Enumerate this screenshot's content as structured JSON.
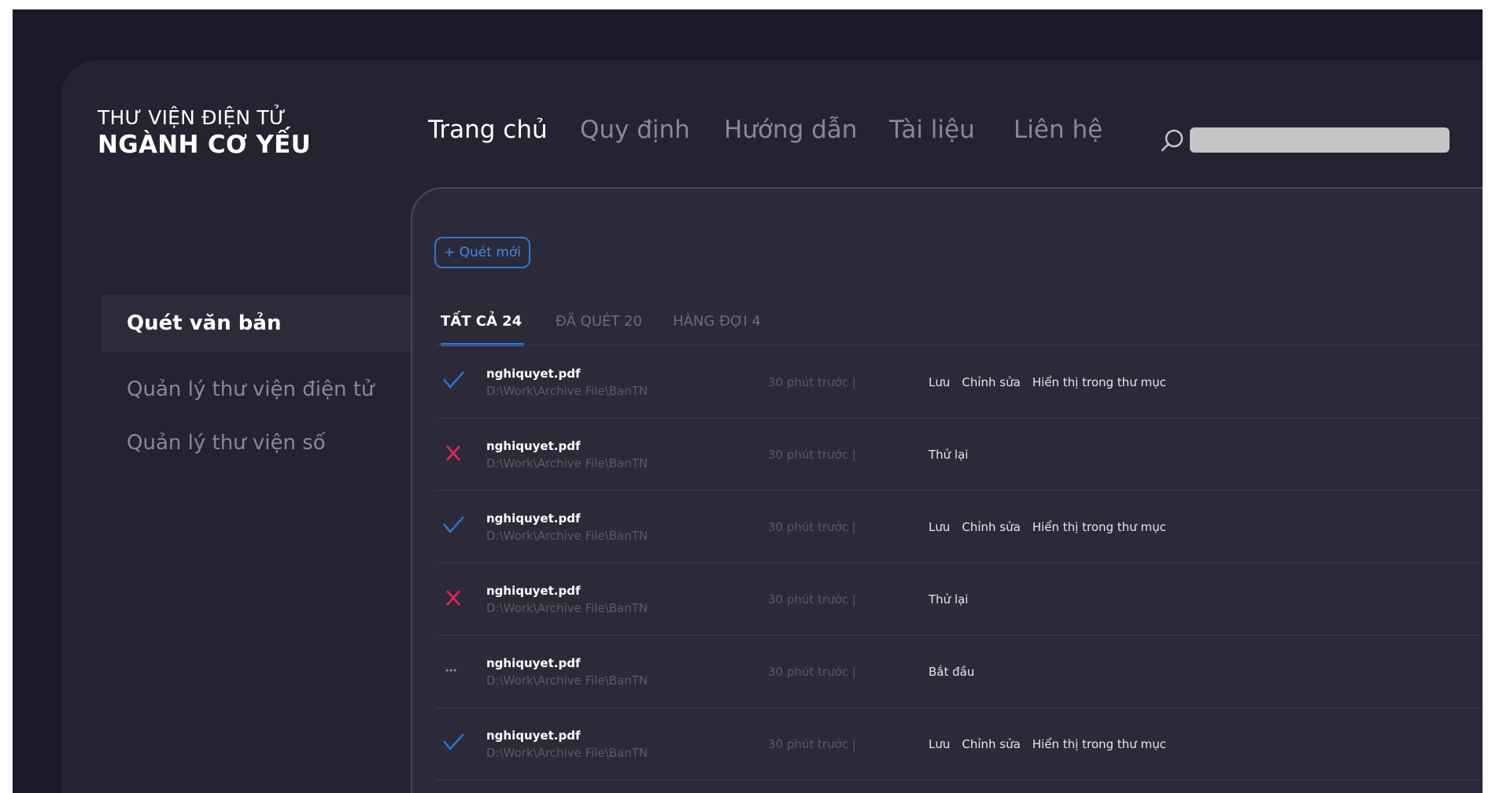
{
  "brand": {
    "line1": "THƯ VIỆN ĐIỆN TỬ",
    "line2": "NGÀNH CƠ YẾU"
  },
  "nav": {
    "items": [
      "Trang chủ",
      "Quy định",
      "Hướng dẫn",
      "Tài liệu",
      "Liên hệ"
    ],
    "active_index": 0,
    "search_placeholder": ""
  },
  "sidebar": {
    "items": [
      "Quét văn bản",
      "Quản lý thư viện điện tử",
      "Quản lý thư viện số"
    ],
    "active_index": 0
  },
  "main": {
    "new_scan_label": "+ Quét mới",
    "tabs": [
      "TẤT CẢ 24",
      "ĐÃ QUÉT 20",
      "HÀNG ĐỢI 4"
    ],
    "active_tab": 0,
    "rows": [
      {
        "status": "success",
        "status_icon": "check-icon",
        "name": "nghiquyet.pdf",
        "path": "D:\\Work\\Archive File\\BanTN",
        "time": "30 phút trước |",
        "actions": [
          "Lưu",
          "Chỉnh sửa",
          "Hiển thị trong thư mục"
        ]
      },
      {
        "status": "failed",
        "status_icon": "error-x-icon",
        "name": "nghiquyet.pdf",
        "path": "D:\\Work\\Archive File\\BanTN",
        "time": "30 phút trước |",
        "actions": [
          "Thử lại"
        ]
      },
      {
        "status": "success",
        "status_icon": "check-icon",
        "name": "nghiquyet.pdf",
        "path": "D:\\Work\\Archive File\\BanTN",
        "time": "30 phút trước |",
        "actions": [
          "Lưu",
          "Chỉnh sửa",
          "Hiển thị trong thư mục"
        ]
      },
      {
        "status": "failed",
        "status_icon": "error-x-icon",
        "name": "nghiquyet.pdf",
        "path": "D:\\Work\\Archive File\\BanTN",
        "time": "30 phút trước |",
        "actions": [
          "Thử lại"
        ]
      },
      {
        "status": "pending",
        "status_icon": "ellipsis-icon",
        "name": "nghiquyet.pdf",
        "path": "D:\\Work\\Archive File\\BanTN",
        "time": "30 phút trước |",
        "actions": [
          "Bắt đầu"
        ]
      },
      {
        "status": "success",
        "status_icon": "check-icon",
        "name": "nghiquyet.pdf",
        "path": "D:\\Work\\Archive File\\BanTN",
        "time": "30 phút trước |",
        "actions": [
          "Lưu",
          "Chỉnh sửa",
          "Hiển thị trong thư mục"
        ]
      }
    ]
  },
  "colors": {
    "background": "#1b1827",
    "app": "#252232",
    "panel": "#2c2a39",
    "accent": "#2f77d4",
    "success": "#2f77d4",
    "error": "#e8255a",
    "muted": "#8a8796"
  }
}
